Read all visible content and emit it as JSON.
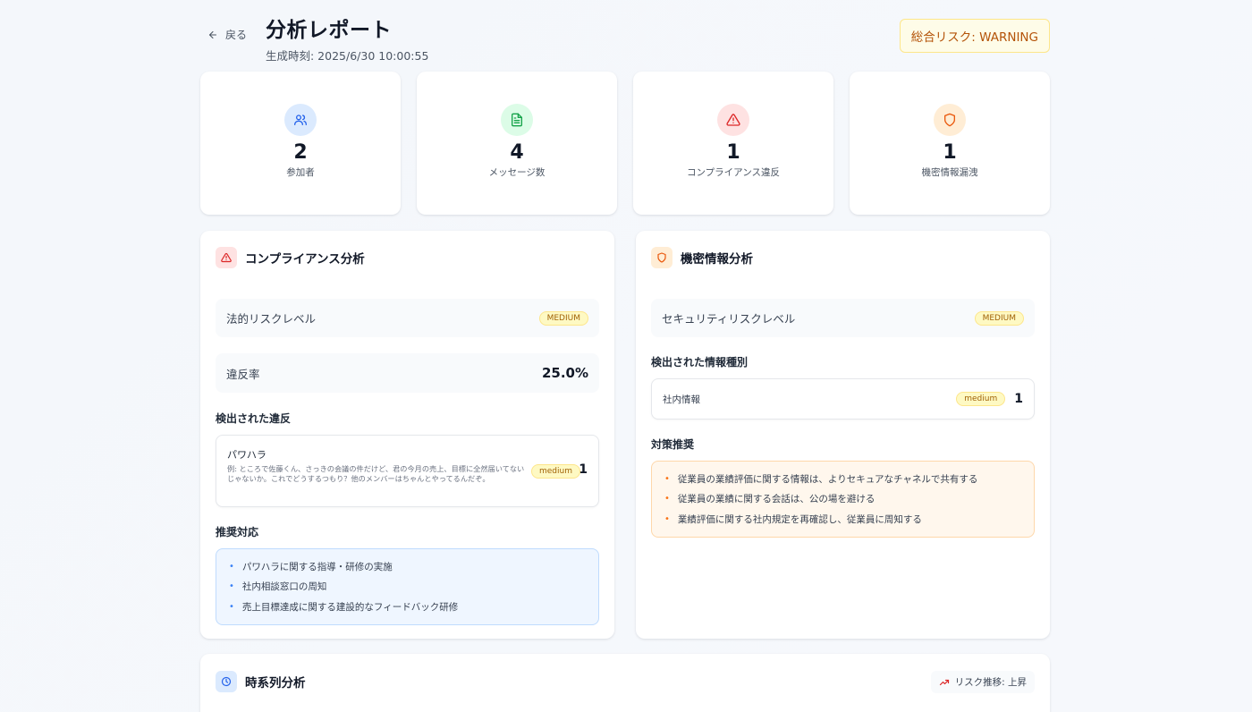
{
  "header": {
    "back_label": "戻る",
    "title": "分析レポート",
    "generated_at": "生成時刻: 2025/6/30 10:00:55",
    "overall_risk": "総合リスク: WARNING"
  },
  "stats": [
    {
      "value": "2",
      "label": "参加者",
      "icon": "users-icon"
    },
    {
      "value": "4",
      "label": "メッセージ数",
      "icon": "document-icon"
    },
    {
      "value": "1",
      "label": "コンプライアンス違反",
      "icon": "warning-icon"
    },
    {
      "value": "1",
      "label": "機密情報漏洩",
      "icon": "shield-icon"
    }
  ],
  "compliance": {
    "title": "コンプライアンス分析",
    "legal_risk_label": "法的リスクレベル",
    "legal_risk_value": "MEDIUM",
    "violation_rate_label": "違反率",
    "violation_rate_value": "25.0%",
    "detected_heading": "検出された違反",
    "violation": {
      "type": "パワハラ",
      "example": "例: ところで佐藤くん、さっきの会議の件だけど、君の今月の売上、目標に全然届いてないじゃないか。これでどうするつもり？他のメンバーはちゃんとやってるんだぞ。",
      "severity": "medium",
      "count": "1"
    },
    "recommend_heading": "推奨対応",
    "recommendations": [
      "パワハラに関する指導・研修の実施",
      "社内相談窓口の周知",
      "売上目標達成に関する建設的なフィードバック研修"
    ]
  },
  "confidential": {
    "title": "機密情報分析",
    "security_risk_label": "セキュリティリスクレベル",
    "security_risk_value": "MEDIUM",
    "types_heading": "検出された情報種別",
    "info_type": {
      "label": "社内情報",
      "severity": "medium",
      "count": "1"
    },
    "measures_heading": "対策推奨",
    "measures": [
      "従業員の業績評価に関する情報は、よりセキュアなチャネルで共有する",
      "従業員の業績に関する会話は、公の場を避ける",
      "業績評価に関する社内規定を再確認し、従業員に周知する"
    ]
  },
  "timeline": {
    "title": "時系列分析",
    "trend_label": "リスク推移: 上昇"
  },
  "colors": {
    "blue": "#3b82f6",
    "green": "#16a34a",
    "red": "#dc2626",
    "orange": "#ea580c",
    "warning_bg": "#fefce8"
  }
}
